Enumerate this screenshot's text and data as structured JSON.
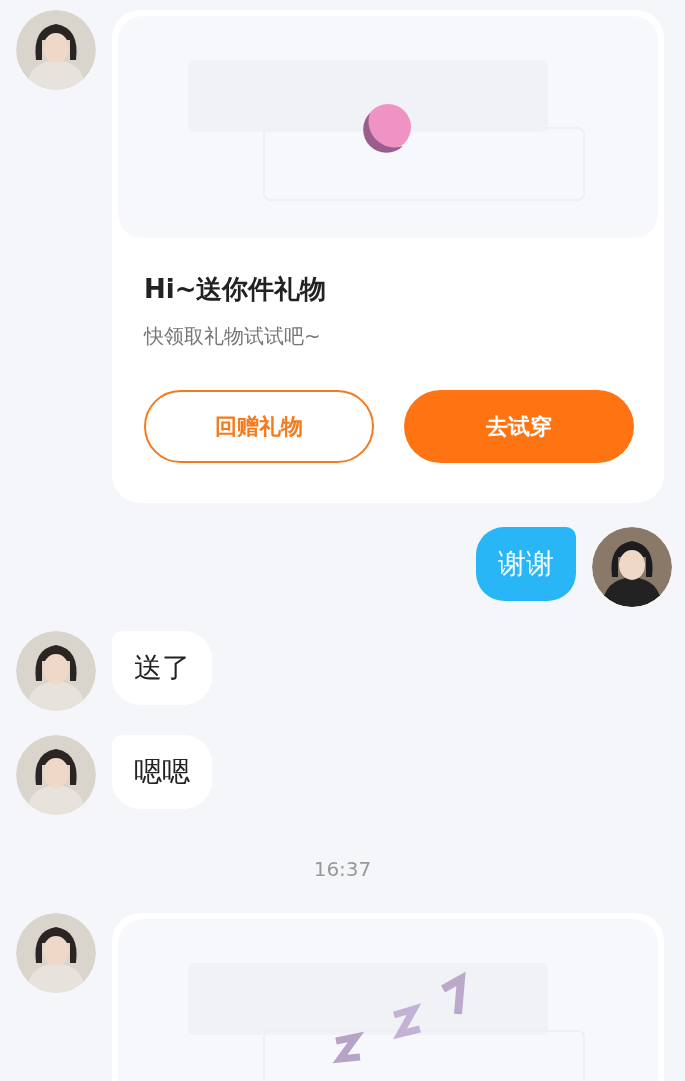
{
  "messages": [
    {
      "kind": "gift_card",
      "outgoing": false,
      "title": "Hi~送你件礼物",
      "subtitle": "快领取礼物试试吧~",
      "buttons": [
        {
          "label": "回赠礼物",
          "kind": "outline"
        },
        {
          "label": "去试穿",
          "kind": "filled"
        }
      ]
    },
    {
      "kind": "text",
      "outgoing": true,
      "text": "谢谢"
    },
    {
      "kind": "text",
      "outgoing": false,
      "text": "送了"
    },
    {
      "kind": "text",
      "outgoing": false,
      "text": "嗯嗯"
    },
    {
      "kind": "time",
      "text": "16:37"
    },
    {
      "kind": "gift_card",
      "outgoing": false
    }
  ]
}
